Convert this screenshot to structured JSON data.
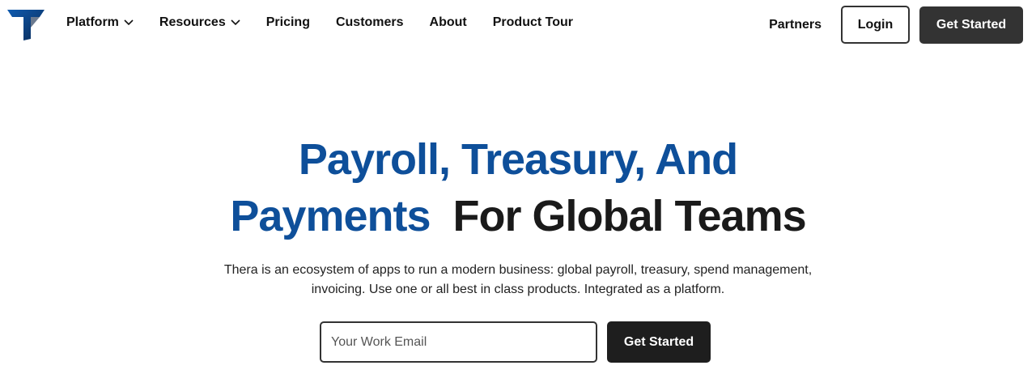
{
  "brand": {
    "logo_icon": "thera-t-logo",
    "primary_color": "#0e4f9a"
  },
  "nav": {
    "items": [
      {
        "label": "Platform",
        "has_dropdown": true
      },
      {
        "label": "Resources",
        "has_dropdown": true
      },
      {
        "label": "Pricing",
        "has_dropdown": false
      },
      {
        "label": "Customers",
        "has_dropdown": false
      },
      {
        "label": "About",
        "has_dropdown": false
      },
      {
        "label": "Product Tour",
        "has_dropdown": false
      }
    ],
    "partners_label": "Partners",
    "login_label": "Login",
    "cta_label": "Get Started"
  },
  "hero": {
    "title_line1": "Payroll, Treasury, And",
    "title_line2_blue": "Payments",
    "title_line2_dark": "For Global Teams",
    "subtitle_line1": "Thera is an ecosystem of apps to run a modern business: global payroll, treasury, spend management,",
    "subtitle_line2": "invoicing. Use one or all best in class products. Integrated as a platform.",
    "email_placeholder": "Your Work Email",
    "cta_label": "Get Started"
  }
}
